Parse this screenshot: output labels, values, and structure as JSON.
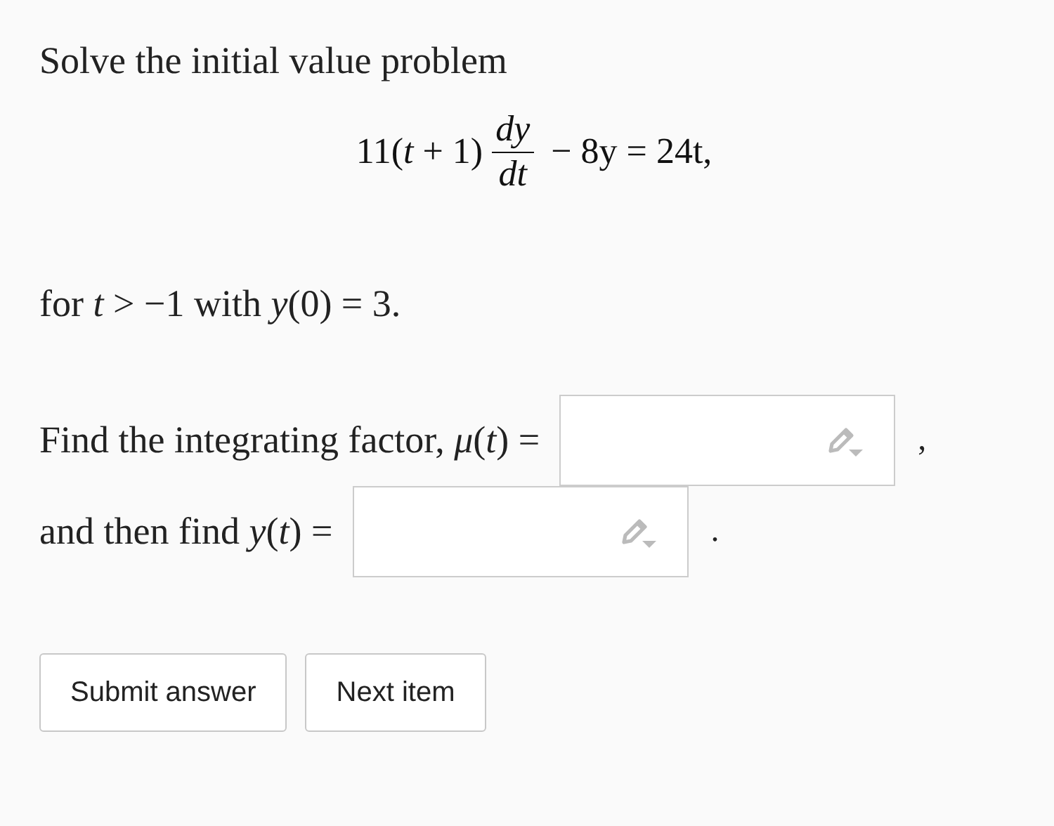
{
  "intro": "Solve the initial value problem",
  "equation": {
    "left": "11(*t* + 1)",
    "numerator": "*dy*",
    "denominator": "*dt*",
    "right": "− 8y = 24t,"
  },
  "condition": "for *t* > −1 with *y*(0) = 3.",
  "questions": [
    {
      "prompt": "Find the integrating factor, *μ*(*t*) =",
      "suffix": ","
    },
    {
      "prompt": "and then find *y*(*t*) =",
      "suffix": "."
    }
  ],
  "buttons": [
    "Submit answer",
    "Next item"
  ]
}
